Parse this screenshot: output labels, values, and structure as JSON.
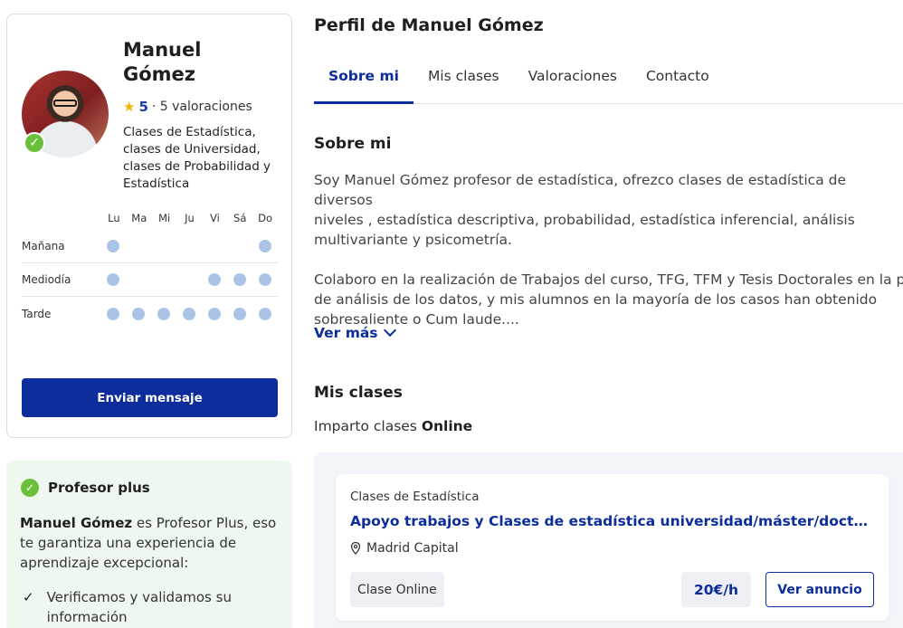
{
  "profile": {
    "name": "Manuel Gómez",
    "rating_value": "5",
    "rating_count": "· 5 valoraciones",
    "subjects": "Clases de Estadística, clases de Universidad, clases de Probabilidad y Estadística",
    "verified": true
  },
  "availability": {
    "days": [
      "Lu",
      "Ma",
      "Mi",
      "Ju",
      "Vi",
      "Sá",
      "Do"
    ],
    "slots": [
      {
        "label": "Mañana",
        "available": [
          true,
          false,
          false,
          false,
          false,
          false,
          true
        ]
      },
      {
        "label": "Mediodía",
        "available": [
          true,
          false,
          false,
          false,
          true,
          true,
          true
        ]
      },
      {
        "label": "Tarde",
        "available": [
          true,
          true,
          true,
          true,
          true,
          true,
          true
        ]
      }
    ]
  },
  "send_button": "Enviar mensaje",
  "plus": {
    "title": "Profesor plus",
    "name_bold": "Manuel Gómez",
    "text": " es Profesor Plus, eso te garantiza una experiencia de aprendizaje excepcional:",
    "item": "Verificamos y validamos su información"
  },
  "page_title": "Perfil de Manuel Gómez",
  "tabs": [
    {
      "label": "Sobre mi",
      "active": true
    },
    {
      "label": "Mis clases",
      "active": false
    },
    {
      "label": "Valoraciones",
      "active": false
    },
    {
      "label": "Contacto",
      "active": false
    }
  ],
  "about": {
    "title": "Sobre mi",
    "paragraph1": "Soy Manuel Gómez profesor de estadística, ofrezco clases de estadística de diversos\nniveles , estadística descriptiva, probabilidad, estadística inferencial, análisis\nmultivariante y psicometría.",
    "paragraph2_line1": "Colaboro en la realización de Trabajos del curso, TFG, TFM y Tesis Doctorales en la parte",
    "paragraph2_rest": "de análisis de los datos, y mis alumnos en la mayoría de los casos han obtenido\nsobresaliente o Cum laude....",
    "see_more": "Ver más"
  },
  "classes": {
    "title": "Mis clases",
    "teaches_prefix": "Imparto clases ",
    "teaches_mode": "Online",
    "card": {
      "category": "Clases de Estadística",
      "title": "Apoyo trabajos y Clases de estadística universidad/máster/doctorado/oposiciones",
      "location": "Madrid Capital",
      "mode": "Clase Online",
      "price": "20€/h",
      "cta": "Ver anuncio"
    }
  },
  "colors": {
    "primary": "#0c2d9b",
    "available_dot": "#aac4e6",
    "verified_green": "#6cbf3a",
    "plus_bg": "#eef8ef"
  },
  "icons": {
    "rating": "star-icon",
    "verified": "check-circle-icon",
    "see_more": "chevron-down-icon",
    "location": "map-pin-icon",
    "list": "checkmark-icon"
  }
}
